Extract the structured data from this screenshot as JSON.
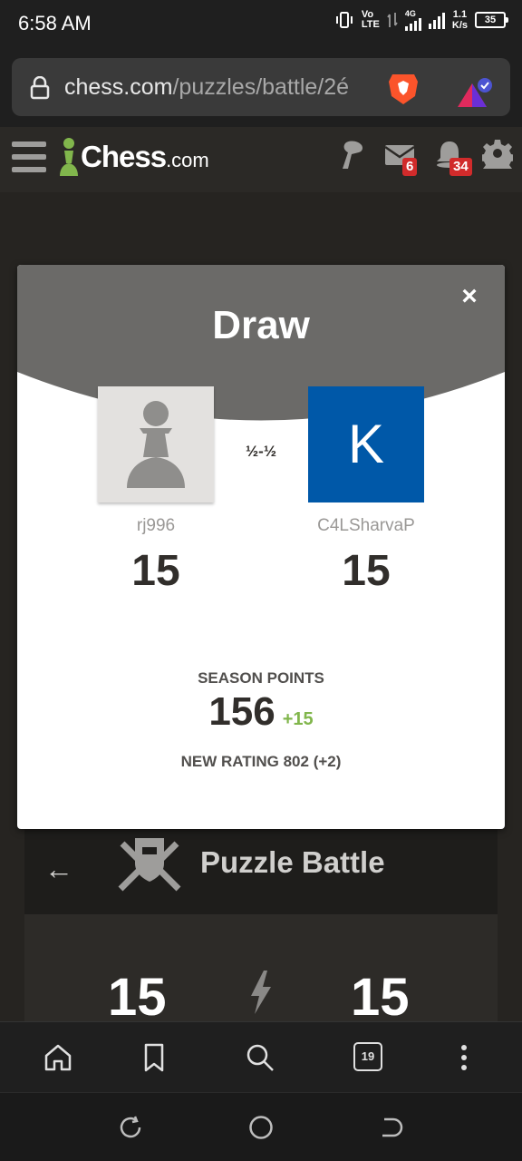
{
  "status": {
    "time": "6:58 AM",
    "volte": "Vo",
    "lte": "LTE",
    "network": "4G",
    "speed_value": "1.1",
    "speed_unit": "K/s",
    "battery": "35"
  },
  "browser": {
    "url_host": "chess.com",
    "url_path": "/puzzles/battle/2é",
    "tab_count": "19"
  },
  "chess_header": {
    "logo_main": "Chess",
    "logo_suffix": ".com",
    "messages_badge": "6",
    "notifications_badge": "34"
  },
  "modal": {
    "result": "Draw",
    "close_label": "×",
    "score_separator": "½-½",
    "player1": {
      "name": "rj996",
      "score": "15"
    },
    "player2": {
      "name": "C4LSharvaP",
      "initial": "K",
      "score": "15",
      "avatar_color": "#0058a8"
    },
    "season_points_label": "SEASON POINTS",
    "season_points_value": "156",
    "season_points_delta": "+15",
    "new_rating": "NEW RATING 802 (+2)"
  },
  "background": {
    "title": "Puzzle Battle",
    "back_icon": "←",
    "score_left": "15",
    "score_right": "15"
  },
  "colors": {
    "accent_green": "#81b64c",
    "badge_red": "#d12b2b"
  }
}
